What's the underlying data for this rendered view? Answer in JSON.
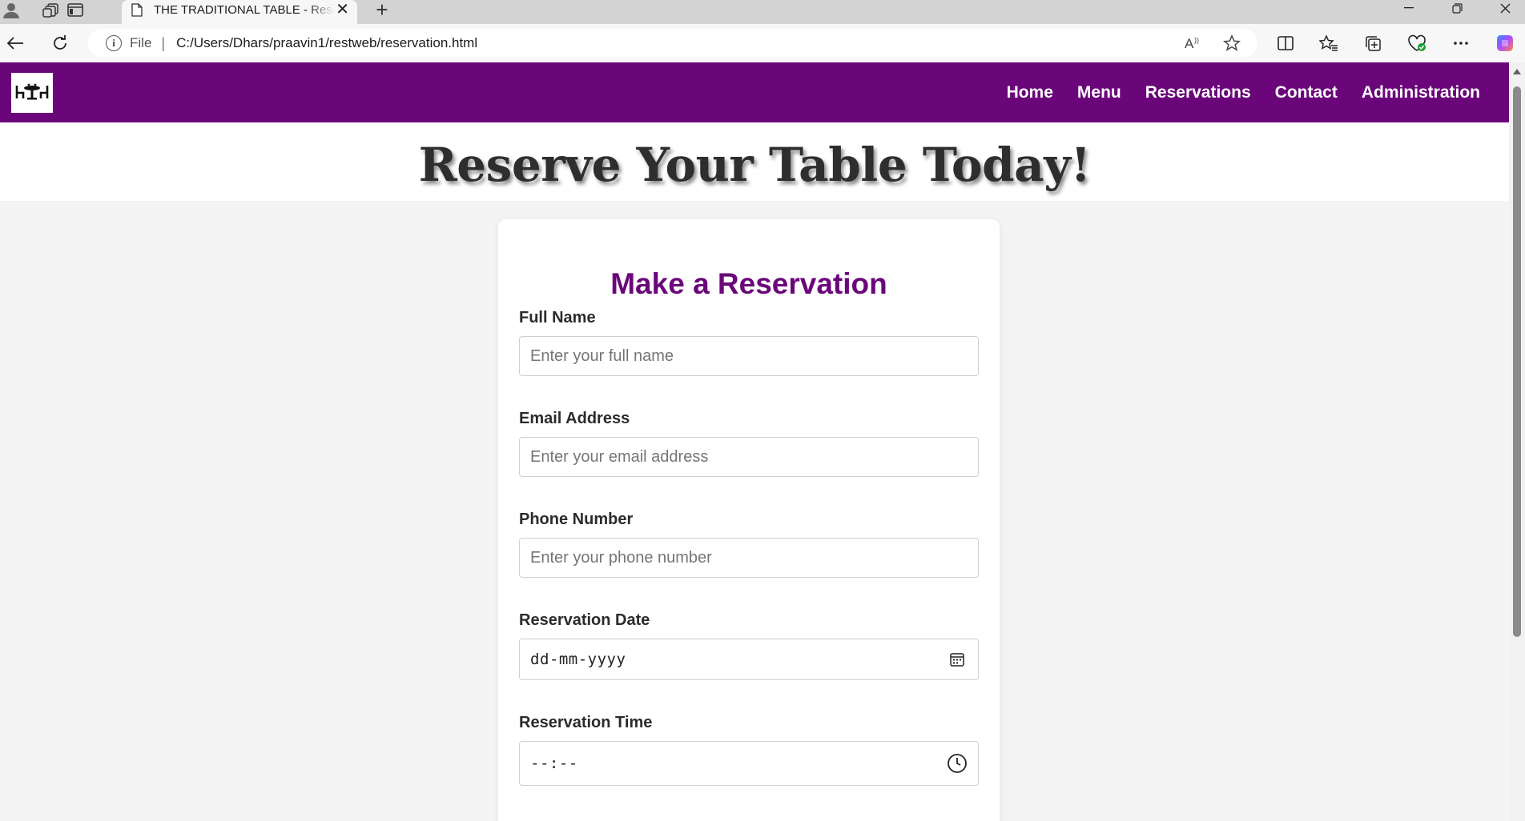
{
  "browser": {
    "tab_title": "THE TRADITIONAL TABLE - Reservation",
    "file_label": "File",
    "separator": "|",
    "url": "C:/Users/Dhars/praavin1/restweb/reservation.html",
    "new_tab_symbol": "+",
    "close_tab_symbol": "✕",
    "icons": [
      "profile-icon",
      "workspaces-icon",
      "vertical-tabs-icon",
      "back-icon",
      "refresh-icon",
      "read-aloud-icon",
      "favorite-star-icon",
      "split-screen-icon",
      "favorites-icon",
      "collections-icon",
      "browser-essentials-icon",
      "more-icon",
      "copilot-icon"
    ]
  },
  "site": {
    "nav": {
      "links": [
        "Home",
        "Menu",
        "Reservations",
        "Contact",
        "Administration"
      ]
    },
    "brand_color": "#6a067a",
    "hero_title": "Reserve Your Table Today!"
  },
  "form": {
    "title": "Make a Reservation",
    "fields": {
      "name": {
        "label": "Full Name",
        "placeholder": "Enter your full name"
      },
      "email": {
        "label": "Email Address",
        "placeholder": "Enter your email address"
      },
      "phone": {
        "label": "Phone Number",
        "placeholder": "Enter your phone number"
      },
      "date": {
        "label": "Reservation Date",
        "value": "dd-mm-yyyy",
        "icon": "calendar-icon"
      },
      "time": {
        "label": "Reservation Time",
        "value": "--:--",
        "icon": "clock-icon"
      }
    }
  }
}
